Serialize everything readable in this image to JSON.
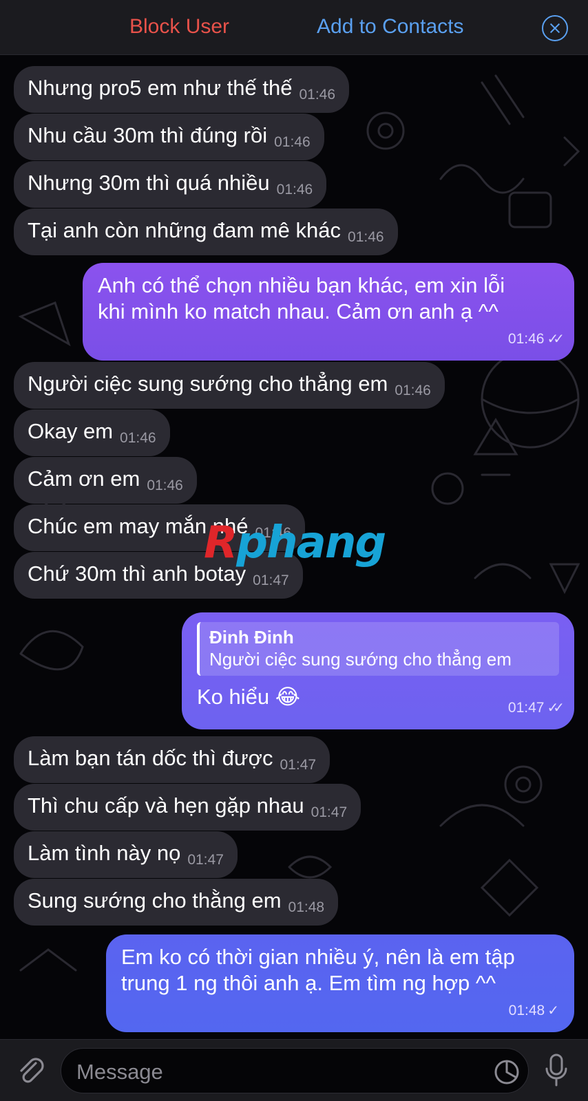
{
  "header": {
    "block_label": "Block User",
    "add_label": "Add to Contacts",
    "block_color": "#e8524a",
    "add_color": "#5aa0f0"
  },
  "watermark": {
    "part1": "R",
    "part2": "phang"
  },
  "messages": {
    "m1": {
      "text": "Nhưng pro5 em như thế thế",
      "time": "01:46"
    },
    "m2": {
      "text": "Nhu cầu 30m thì đúng rồi",
      "time": "01:46"
    },
    "m3": {
      "text": "Nhưng 30m thì quá nhiều",
      "time": "01:46"
    },
    "m4": {
      "text": "Tại anh còn những đam mê khác",
      "time": "01:46"
    },
    "o1": {
      "text": "Anh có thể chọn nhiều bạn khác, em xin lỗi\nkhi mình ko match nhau. Cảm ơn anh ạ ^^",
      "time": "01:46"
    },
    "m5": {
      "text": "Người ciệc sung sướng cho thẳng em",
      "time": "01:46"
    },
    "m6": {
      "text": "Okay em",
      "time": "01:46"
    },
    "m7": {
      "text": "Cảm ơn em",
      "time": "01:46"
    },
    "m8": {
      "text": "Chúc em may mắn nhé",
      "time": "01:46"
    },
    "m9": {
      "text": "Chứ 30m thì anh botay",
      "time": "01:47"
    },
    "o2": {
      "reply_name": "Đinh Đinh",
      "reply_text": "Người ciệc sung sướng cho thẳng em",
      "text": "Ko hiểu 😂",
      "time": "01:47"
    },
    "m10": {
      "text": "Làm bạn tán dốc thì được",
      "time": "01:47"
    },
    "m11": {
      "text": "Thì chu cấp và hẹn gặp nhau",
      "time": "01:47"
    },
    "m12": {
      "text": "Làm tình này nọ",
      "time": "01:47"
    },
    "m13": {
      "text": "Sung sướng cho thằng em",
      "time": "01:48"
    },
    "o3": {
      "text": "Em ko có thời gian nhiều ý, nên là em tập\ntrung 1 ng thôi anh ạ. Em tìm ng hợp ^^",
      "time": "01:48"
    }
  },
  "composer": {
    "placeholder": "Message"
  }
}
